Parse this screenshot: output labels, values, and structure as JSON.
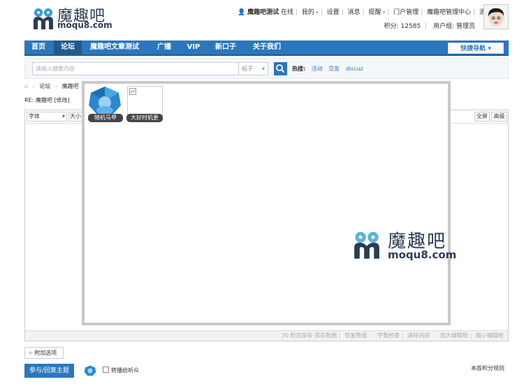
{
  "brand": {
    "name": "魔趣吧",
    "domain": "moqu8.com"
  },
  "topbar": {
    "username": "魔趣吧测试",
    "online": "在线",
    "mine": "我的",
    "settings": "设置",
    "messages": "消息",
    "remind": "提醒",
    "portal_admin": "门户管理",
    "admin_center": "魔趣吧管理中心",
    "logout": "退出"
  },
  "userbar": {
    "points_label": "积分: 12585",
    "group_label": "用户组: 管理员"
  },
  "nav": {
    "items": [
      "首页",
      "论坛",
      "魔趣吧文章测试",
      "广播",
      "VIP",
      "新口子",
      "关于我们"
    ],
    "quick_nav": "快捷导航"
  },
  "search": {
    "placeholder": "请输入搜索内容",
    "type": "帖子",
    "hot_label": "热搜:",
    "hot_words": [
      "活动",
      "交友",
      "discuz"
    ]
  },
  "breadcrumb": {
    "forum": "论坛",
    "current": "魔趣吧"
  },
  "post": {
    "re_line": "RE: 魔趣吧 [修改]"
  },
  "editor": {
    "font": "字体",
    "size": "大小",
    "fullscreen": "全屏",
    "advanced": "高级",
    "status": {
      "autosave": "30 秒后保存",
      "save": "保存数据",
      "restore": "恢复数据",
      "wordcount": "字数检查",
      "clear": "清除内容",
      "enlarge": "加大编辑框",
      "shrink": "缩小编辑框"
    }
  },
  "popup": {
    "vest1": "随机马甲",
    "vest2": "大好时机更"
  },
  "watermark": {
    "name": "魔趣吧",
    "domain": "moqu8.com"
  },
  "footer": {
    "addon": "附加选项",
    "submit": "参与/回复主题",
    "forward_label": "转播给听众",
    "rules": "本版积分规则"
  },
  "colors": {
    "primary": "#2b77bd",
    "nav_active": "#1f5a91"
  }
}
